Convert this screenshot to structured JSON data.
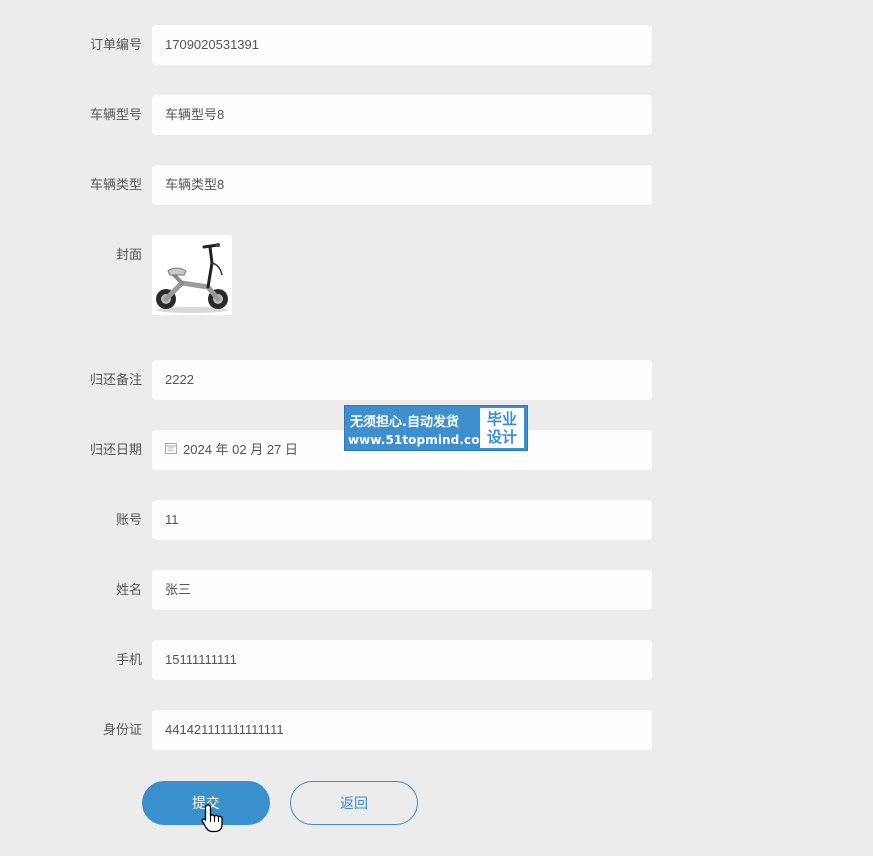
{
  "form": {
    "fields": [
      {
        "label": "订单编号",
        "value": "1709020531391"
      },
      {
        "label": "车辆型号",
        "value": "车辆型号8"
      },
      {
        "label": "车辆类型",
        "value": "车辆类型8"
      }
    ],
    "cover": {
      "label": "封面",
      "image_icon": "electric-scooter-image"
    },
    "fields2": [
      {
        "label": "归还备注",
        "value": "2222"
      },
      {
        "label": "归还日期",
        "value": "2024 年 02 月 27 日",
        "icon": "calendar-icon"
      },
      {
        "label": "账号",
        "value": "11"
      },
      {
        "label": "姓名",
        "value": "张三"
      },
      {
        "label": "手机",
        "value": "15111111111"
      },
      {
        "label": "身份证",
        "value": "441421111111111111"
      }
    ]
  },
  "buttons": {
    "submit": "提交",
    "back": "返回"
  },
  "watermark": {
    "line1": "无须担心.自动发货",
    "line2": "www.51topmind.com",
    "side": "毕业设计"
  },
  "colors": {
    "background": "#ececec",
    "field": "#fdfdfd",
    "accent": "#3a8fcd"
  }
}
